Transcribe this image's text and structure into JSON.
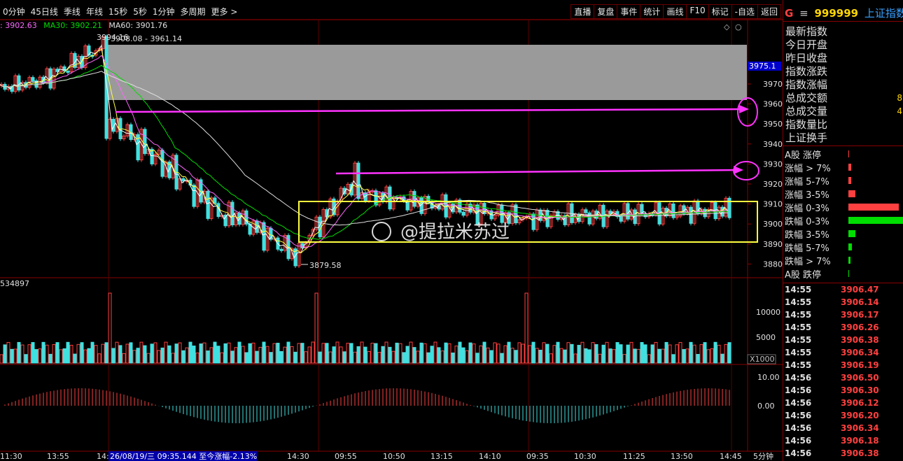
{
  "topbar": {
    "tabs": [
      "0分钟",
      "45日线",
      "季线",
      "年线",
      "15秒",
      "5秒",
      "1分钟",
      "多周期",
      "更多 >"
    ],
    "tools": [
      "直播",
      "复盘",
      "事件",
      "统计",
      "画线",
      "F10",
      "标记",
      "-自选",
      "返回"
    ]
  },
  "ma": {
    "ma10": ": 3902.63",
    "ma30": "MA30: 3902.21",
    "ma60": "MA60: 3901.76",
    "colors": {
      "ma10": "#ff66ff",
      "ma30": "#00dd00",
      "ma60": "#e0e0e0"
    }
  },
  "price_axis": {
    "labels": [
      "3970",
      "3960",
      "3950",
      "3940",
      "3930",
      "3920",
      "3910",
      "3900",
      "3890",
      "3880"
    ],
    "current": "3975.1"
  },
  "annotations": {
    "high_label": "3994.16",
    "range_label": "3908.08 - 3961.14",
    "low_label": "3879.58",
    "watermark": "@提拉米苏过"
  },
  "volume": {
    "header": "534897",
    "labels": [
      "10000",
      "5000"
    ],
    "unit": "X1000"
  },
  "macd": {
    "labels": [
      "10.00",
      "0.00"
    ]
  },
  "time_axis": {
    "labels": [
      "11:30",
      "13:55",
      "14:",
      "14:30",
      "09:55",
      "10:50",
      "13:15",
      "14:10",
      "09:35",
      "10:30",
      "11:25",
      "13:50",
      "14:45"
    ],
    "status": "26/08/19/三 09:35.144 至今涨幅-2.13%",
    "period": "5分钟"
  },
  "side": {
    "title_g": "G",
    "title_eq": "≡",
    "code": "999999",
    "name": "上证指数",
    "stats": [
      {
        "label": "最新指数",
        "value": ""
      },
      {
        "label": "今日开盘",
        "value": ""
      },
      {
        "label": "昨日收盘",
        "value": ""
      },
      {
        "label": "指数涨跌",
        "value": ""
      },
      {
        "label": "指数涨幅",
        "value": ""
      },
      {
        "label": "总成交额",
        "value": "8"
      },
      {
        "label": "总成交量",
        "value": "4"
      },
      {
        "label": "指数量比",
        "value": ""
      },
      {
        "label": "上证换手",
        "value": ""
      }
    ],
    "distribution": [
      {
        "label": "A股 涨停",
        "color": "#ff4040",
        "share": 0.01
      },
      {
        "label": "涨幅 > 7%",
        "color": "#ff4040",
        "share": 0.06
      },
      {
        "label": "涨幅 5-7%",
        "color": "#ff4040",
        "share": 0.05
      },
      {
        "label": "涨幅 3-5%",
        "color": "#ff4040",
        "share": 0.14
      },
      {
        "label": "涨幅 0-3%",
        "color": "#ff4040",
        "share": 1.0
      },
      {
        "label": "跌幅 0-3%",
        "color": "#00dd00",
        "share": 1.1
      },
      {
        "label": "跌幅 3-5%",
        "color": "#00dd00",
        "share": 0.14
      },
      {
        "label": "跌幅 5-7%",
        "color": "#00dd00",
        "share": 0.07
      },
      {
        "label": "跌幅 > 7%",
        "color": "#00dd00",
        "share": 0.04
      },
      {
        "label": "A股 跌停",
        "color": "#00dd00",
        "share": 0.01
      }
    ],
    "ticks": [
      {
        "time": "14:55",
        "price": "3906.47"
      },
      {
        "time": "14:55",
        "price": "3906.14"
      },
      {
        "time": "14:55",
        "price": "3906.17"
      },
      {
        "time": "14:55",
        "price": "3906.26"
      },
      {
        "time": "14:55",
        "price": "3906.38"
      },
      {
        "time": "14:55",
        "price": "3906.34"
      },
      {
        "time": "14:55",
        "price": "3906.19"
      },
      {
        "time": "14:56",
        "price": "3906.50"
      },
      {
        "time": "14:56",
        "price": "3906.30"
      },
      {
        "time": "14:56",
        "price": "3906.12"
      },
      {
        "time": "14:56",
        "price": "3906.20"
      },
      {
        "time": "14:56",
        "price": "3906.34"
      },
      {
        "time": "14:56",
        "price": "3906.18"
      },
      {
        "time": "14:56",
        "price": "3906.38"
      }
    ]
  }
}
